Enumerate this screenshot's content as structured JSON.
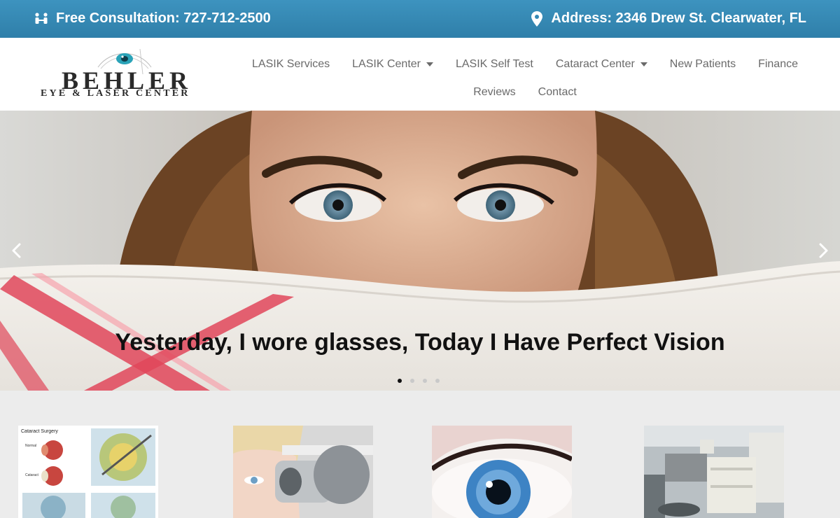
{
  "topbar": {
    "consultation": "Free Consultation: 727-712-2500",
    "address": "Address: 2346 Drew St. Clearwater, FL"
  },
  "logo": {
    "word1": "BEHLER",
    "word2": "EYE & LASER CENTER"
  },
  "nav": {
    "row1": [
      {
        "label": "LASIK Services",
        "dropdown": false
      },
      {
        "label": "LASIK Center",
        "dropdown": true
      },
      {
        "label": "LASIK Self Test",
        "dropdown": false
      },
      {
        "label": "Cataract Center",
        "dropdown": true
      },
      {
        "label": "New Patients",
        "dropdown": false
      },
      {
        "label": "Finance",
        "dropdown": false
      }
    ],
    "row2": [
      {
        "label": "Reviews",
        "dropdown": false
      },
      {
        "label": "Contact",
        "dropdown": false
      }
    ]
  },
  "hero": {
    "caption": "Yesterday, I wore glasses, Today I Have Perfect Vision",
    "slide_count": 4,
    "active_slide": 1
  },
  "thumb1": {
    "title": "Cataract Surgery",
    "label_normal": "Normal",
    "label_cataract": "Cataract"
  },
  "colors": {
    "topbar": "#3589b5",
    "nav_text": "#6a6a6a",
    "page_bg": "#ececec"
  }
}
